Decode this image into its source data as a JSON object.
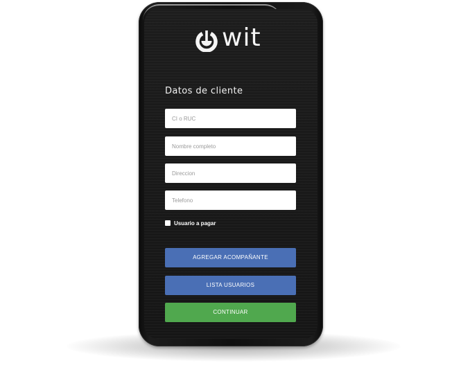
{
  "app": {
    "logo_text": "wit",
    "logo_icon": "power-button-logo"
  },
  "form": {
    "title": "Datos de cliente",
    "fields": [
      {
        "placeholder": "CI o RUC",
        "value": ""
      },
      {
        "placeholder": "Nombre completo",
        "value": ""
      },
      {
        "placeholder": "Direccion",
        "value": ""
      },
      {
        "placeholder": "Telefono",
        "value": ""
      }
    ],
    "checkbox": {
      "label": "Usuario a pagar",
      "checked": false
    }
  },
  "buttons": {
    "add_companion": "AGREGAR ACOMPAÑANTE",
    "user_list": "LISTA USUARIOS",
    "continue": "CONTINUAR"
  },
  "colors": {
    "primary_blue": "#4a6fb5",
    "success_green": "#50a84e",
    "screen_background": "#1a1a1a"
  }
}
